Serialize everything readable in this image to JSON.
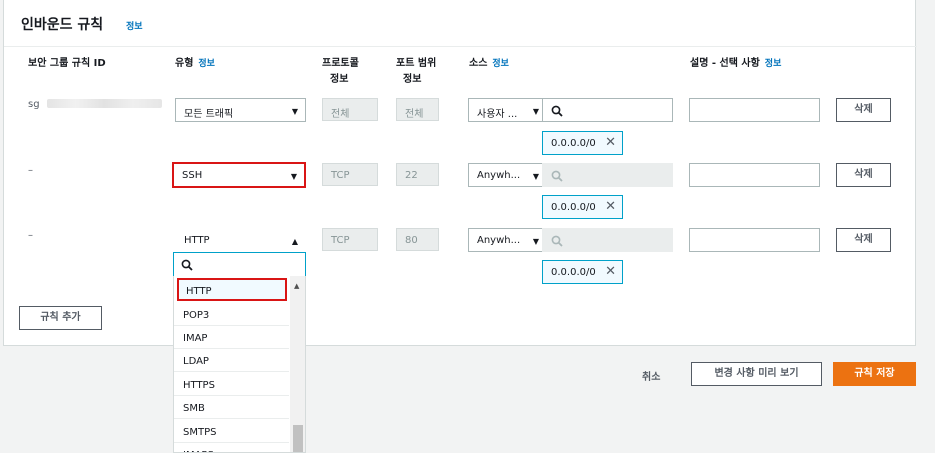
{
  "panel": {
    "title": "인바운드 규칙",
    "info": "정보"
  },
  "columns": {
    "rule_id": "보안 그룹 규칙 ID",
    "type": "유형",
    "type_info": "정보",
    "protocol": "프로토콜",
    "protocol_info": "정보",
    "port_range": "포트 범위",
    "port_info": "정보",
    "source": "소스",
    "source_info": "정보",
    "description": "설명 - 선택 사항",
    "description_info": "정보"
  },
  "rules": [
    {
      "id": "sg",
      "type": "모든 트래픽",
      "protocol": "전체",
      "port": "전체",
      "source": "사용자 ...",
      "cidr": "0.0.0.0/0",
      "delete": "삭제"
    },
    {
      "id": "–",
      "type": "SSH",
      "protocol": "TCP",
      "port": "22",
      "source": "Anywh...",
      "cidr": "0.0.0.0/0",
      "delete": "삭제"
    },
    {
      "id": "–",
      "type": "HTTP",
      "protocol": "TCP",
      "port": "80",
      "source": "Anywh...",
      "cidr": "0.0.0.0/0",
      "delete": "삭제"
    }
  ],
  "dropdown_options": [
    "HTTP",
    "POP3",
    "IMAP",
    "LDAP",
    "HTTPS",
    "SMB",
    "SMTPS",
    "IMAPS"
  ],
  "add_rule": "규칙 추가",
  "footer": {
    "cancel": "취소",
    "preview": "변경 사항 미리 보기",
    "save": "규칙 저장"
  },
  "icons": {
    "search": "search-icon",
    "remove": "close-icon",
    "dropdown": "caret-down-icon"
  },
  "colors": {
    "accent": "#ec7211",
    "link": "#0073bb",
    "highlight": "#d91515",
    "focus": "#00a1c9"
  }
}
